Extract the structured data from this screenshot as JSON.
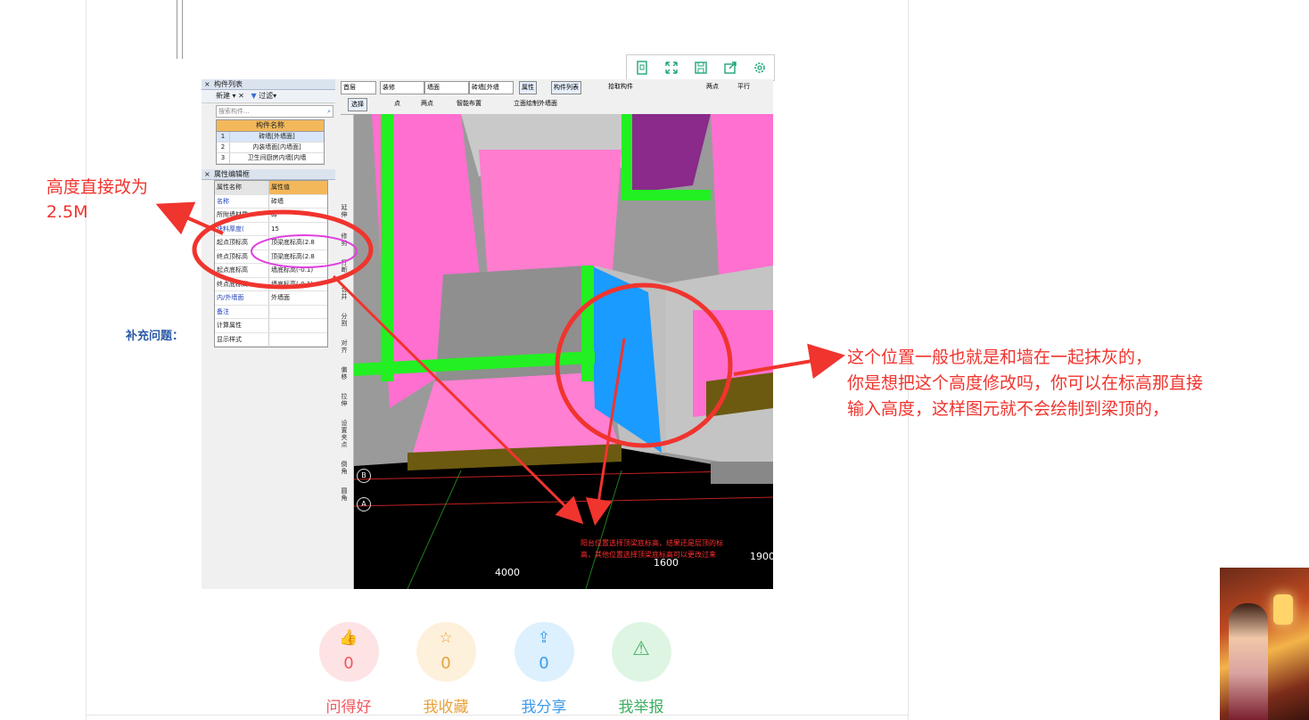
{
  "panel": {
    "list_title": "构件列表",
    "new_label": "新建",
    "filter_label": "过滤",
    "search_placeholder": "搜索构件...",
    "col_name": "构件名称",
    "components": [
      {
        "n": "1",
        "name": "砖墙[外墙面]"
      },
      {
        "n": "2",
        "name": "内装墙面[内墙面]"
      },
      {
        "n": "3",
        "name": "卫生间厨房内墙[内墙"
      }
    ],
    "prop_title": "属性编辑框",
    "prop_head": {
      "k": "属性名称",
      "v": "属性值"
    },
    "props": [
      {
        "k": "名称",
        "v": "砖墙"
      },
      {
        "k": "所附墙材质",
        "v": "砖"
      },
      {
        "k": "块料厚度(",
        "v": "15"
      },
      {
        "k": "起点顶标高",
        "v": "顶梁底标高(2.8"
      },
      {
        "k": "终点顶标高",
        "v": "顶梁底标高(2.8"
      },
      {
        "k": "起点底标高",
        "v": "墙底标高(-0.1)"
      },
      {
        "k": "终点底标高",
        "v": "墙底标高(-0.1)"
      },
      {
        "k": "内/外墙面",
        "v": "外墙面"
      },
      {
        "k": "备注",
        "v": ""
      },
      {
        "k": "计算属性",
        "v": ""
      },
      {
        "k": "显示样式",
        "v": ""
      }
    ]
  },
  "toolbar": {
    "floor": "首层",
    "category": "装修",
    "type": "墙面",
    "element": "砖墙[外墙",
    "attr": "属性",
    "list": "构件列表",
    "pick": "拾取构件",
    "two_pt": "两点",
    "parallel": "平行",
    "select": "选择",
    "point": "点",
    "two_point": "两点",
    "smart": "智能布置",
    "elev": "立面绘制外墙面"
  },
  "vstrip": [
    "延伸",
    "修剪",
    "打断",
    "合并",
    "分割",
    "对齐",
    "偏移",
    "拉伸",
    "设置夹点",
    "倒角",
    "圆角"
  ],
  "viewport": {
    "caption_line1": "阳台位置选择顶梁底标高，结果还是层顶的标",
    "caption_line2": "高，其他位置选择顶梁底标高可以更改过来",
    "dim_4000": "4000",
    "dim_1600": "1600",
    "dim_1900": "1900",
    "axis_b": "B",
    "axis_a": "A"
  },
  "annotations": {
    "left_line1": "高度直接改为",
    "left_line2": "2.5M",
    "right_line1": "这个位置一般也就是和墙在一起抹灰的，",
    "right_line2": "你是想把这个高度修改吗，你可以在标高那直接",
    "right_line3": "输入高度，这样图元就不会绘制到梁顶的，",
    "supplement": "补充问题："
  },
  "actions": [
    {
      "label": "问得好",
      "count": "0",
      "icon": "thumbs-up-icon",
      "color": "#f0575f",
      "bg": "#fde3e4"
    },
    {
      "label": "我收藏",
      "count": "0",
      "icon": "star-icon",
      "color": "#e6a23c",
      "bg": "#fdf1dc"
    },
    {
      "label": "我分享",
      "count": "0",
      "icon": "share-icon",
      "color": "#3d9be9",
      "bg": "#dcf0fd"
    },
    {
      "label": "我举报",
      "count": "",
      "icon": "warning-icon",
      "color": "#3fae62",
      "bg": "#dff5e3"
    }
  ],
  "colors": {
    "annotation_red": "#f0342e",
    "toolbar_green": "#1fa67a",
    "link_blue": "#2a5aa8"
  }
}
